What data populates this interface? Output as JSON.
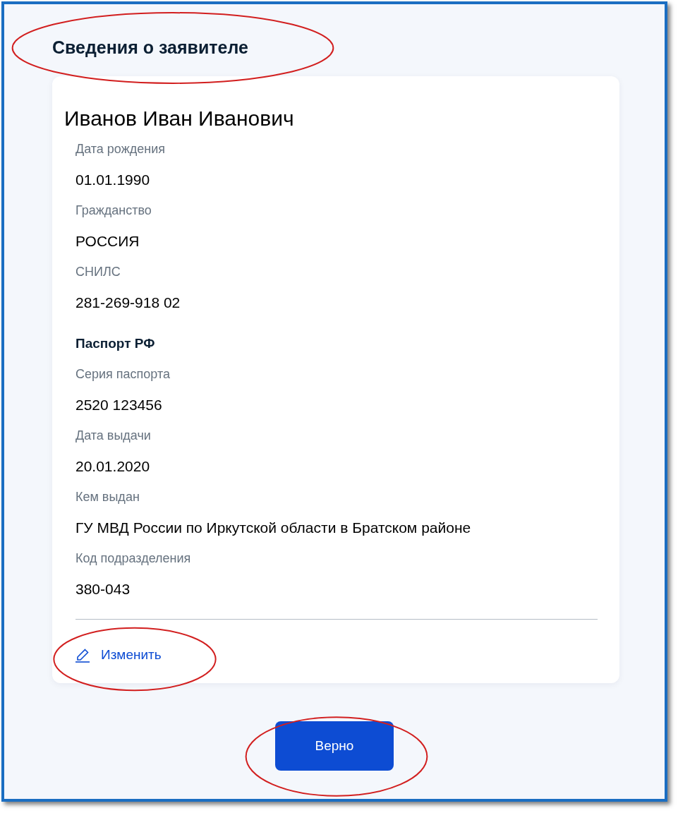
{
  "title": "Сведения о заявителе",
  "applicant": {
    "name": "Иванов Иван Иванович",
    "fields": [
      {
        "kind": "field",
        "label": "Дата рождения",
        "value": "01.01.1990"
      },
      {
        "kind": "field",
        "label": "Гражданство",
        "value": "РОССИЯ"
      },
      {
        "kind": "field",
        "label": "СНИЛС",
        "value": "281-269-918 02"
      },
      {
        "kind": "section",
        "label": "Паспорт РФ"
      },
      {
        "kind": "field",
        "label": "Серия паспорта",
        "value": "2520 123456"
      },
      {
        "kind": "field",
        "label": "Дата выдачи",
        "value": "20.01.2020"
      },
      {
        "kind": "field",
        "label": "Кем выдан",
        "value": "ГУ МВД России по Иркутской области в Братском районе"
      },
      {
        "kind": "field",
        "label": "Код подразделения",
        "value": "380-043"
      }
    ],
    "edit_link": "Изменить"
  },
  "confirm_button": "Верно"
}
